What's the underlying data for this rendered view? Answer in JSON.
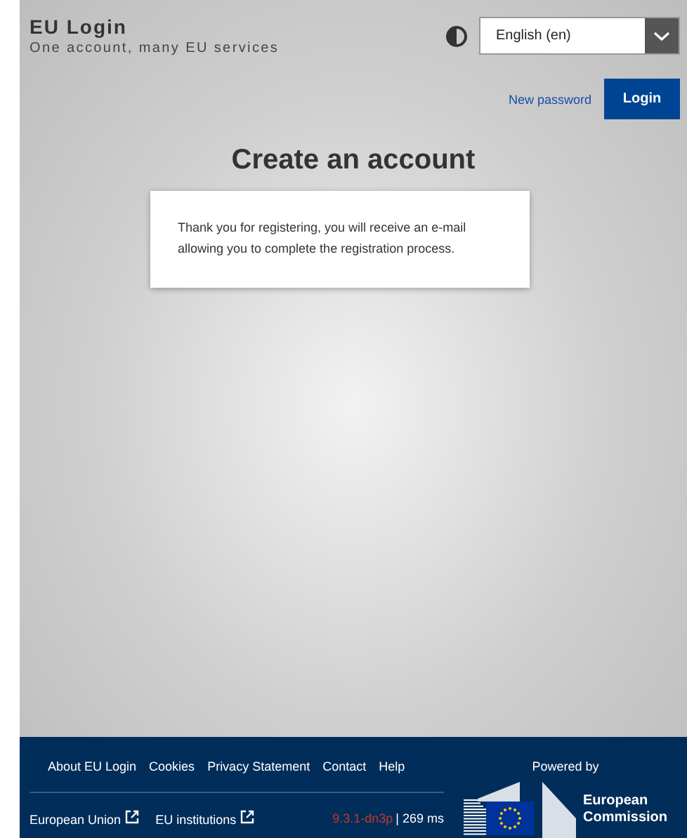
{
  "header": {
    "title": "EU Login",
    "subtitle": "One account, many EU services",
    "language": "English (en)"
  },
  "nav": {
    "new_password": "New password",
    "login": "Login"
  },
  "main": {
    "heading": "Create an account",
    "message": "Thank you for registering, you will receive an e-mail allowing you to complete the registration process."
  },
  "footer": {
    "links": [
      "About EU Login",
      "Cookies",
      "Privacy Statement",
      "Contact",
      "Help"
    ],
    "external_links": [
      "European Union",
      "EU institutions"
    ],
    "version": "9.3.1-dn3p",
    "timing": "| 269 ms",
    "powered_by": "Powered by",
    "logo_text": [
      "European",
      "Commission"
    ]
  }
}
